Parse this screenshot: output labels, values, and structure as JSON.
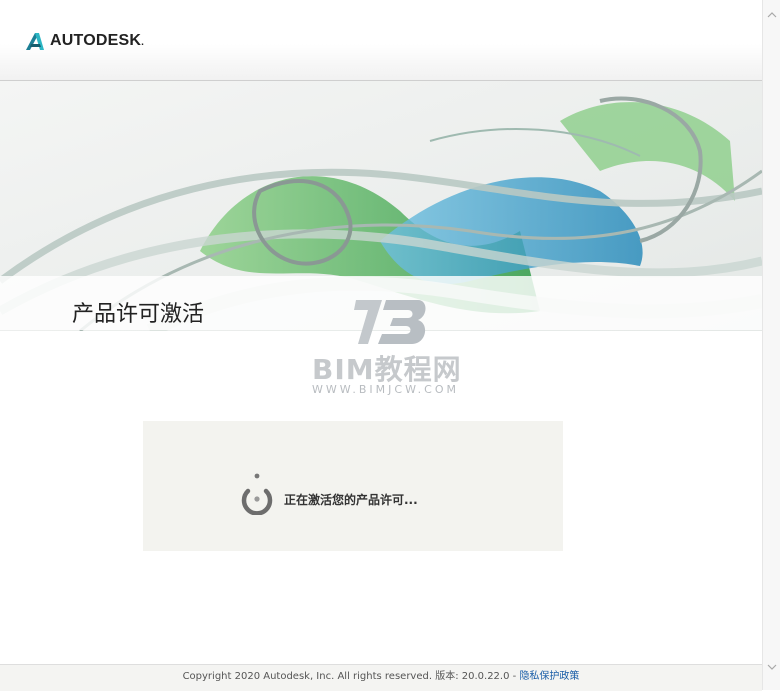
{
  "header": {
    "brand": "AUTODESK",
    "brand_mark": "."
  },
  "page": {
    "title": "产品许可激活"
  },
  "watermark": {
    "name": "BIM教程网",
    "url": "WWW.BIMJCW.COM"
  },
  "status": {
    "message": "正在激活您的产品许可..."
  },
  "footer": {
    "copyright": "Copyright 2020 Autodesk, Inc. All rights reserved. 版本: 20.0.22.0 - ",
    "privacy_link": "隐私保护政策"
  },
  "icons": {
    "logo": "autodesk-logo-icon",
    "spinner": "loading-spinner-icon",
    "scroll_up": "chevron-up-icon",
    "scroll_down": "chevron-down-icon"
  },
  "colors": {
    "link": "#1a5ea8",
    "status_bg": "#f3f3ef"
  }
}
